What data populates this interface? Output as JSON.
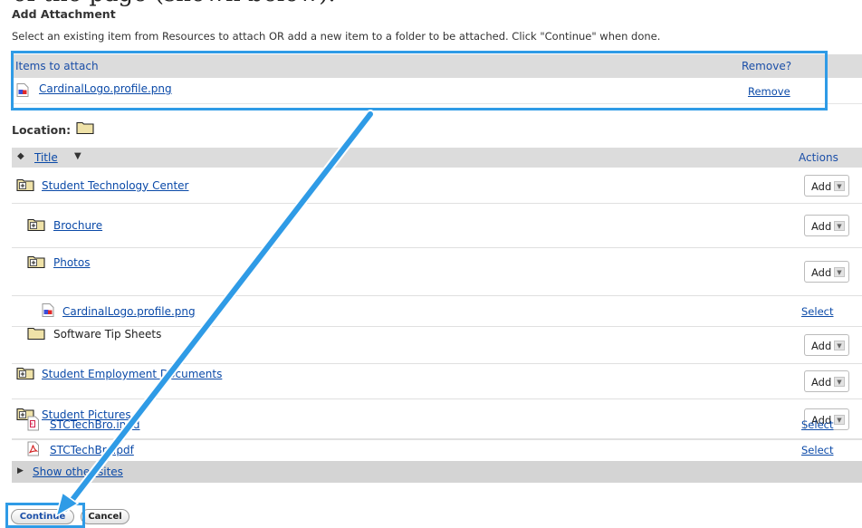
{
  "caption_cut": "of the page (shown below).",
  "heading": "Add Attachment",
  "instructions": "Select an existing item from Resources to attach OR add a new item to a folder to be attached. Click \"Continue\" when done.",
  "attach": {
    "header_left": "Items to attach",
    "header_right": "Remove?",
    "item_name": "CardinalLogo.profile.png",
    "remove_label": "Remove"
  },
  "location_label": "Location:",
  "table": {
    "title_col": "Title",
    "actions_col": "Actions",
    "rows": [
      {
        "name": "Student Technology Center",
        "icon": "folder-plus-icon",
        "action": "Add"
      },
      {
        "name": "Brochure",
        "icon": "folder-plus-icon",
        "action": "Add"
      },
      {
        "name": "Photos",
        "icon": "folder-plus-icon",
        "action": "Add"
      },
      {
        "name": "CardinalLogo.profile.png",
        "icon": "image-file-icon",
        "action": "Select"
      },
      {
        "name": "Software Tip Sheets",
        "icon": "folder-icon",
        "action": "Add"
      },
      {
        "name": "Student Employment Documents",
        "icon": "folder-plus-icon",
        "action": "Add"
      },
      {
        "name": "Student Pictures",
        "icon": "folder-plus-icon",
        "action": "Add"
      },
      {
        "name": "STCTechBro.indd",
        "icon": "indesign-file-icon",
        "action": "Select"
      },
      {
        "name": "STCTechBro.pdf",
        "icon": "pdf-file-icon",
        "action": "Select"
      }
    ]
  },
  "show_other": "Show other sites",
  "buttons": {
    "continue": "Continue",
    "cancel": "Cancel"
  },
  "colors": {
    "accent_blue": "#2f9be6",
    "link_blue": "#0b4aa8",
    "header_gray": "#dcdcdc",
    "folder_tan": "#efe2a8"
  }
}
